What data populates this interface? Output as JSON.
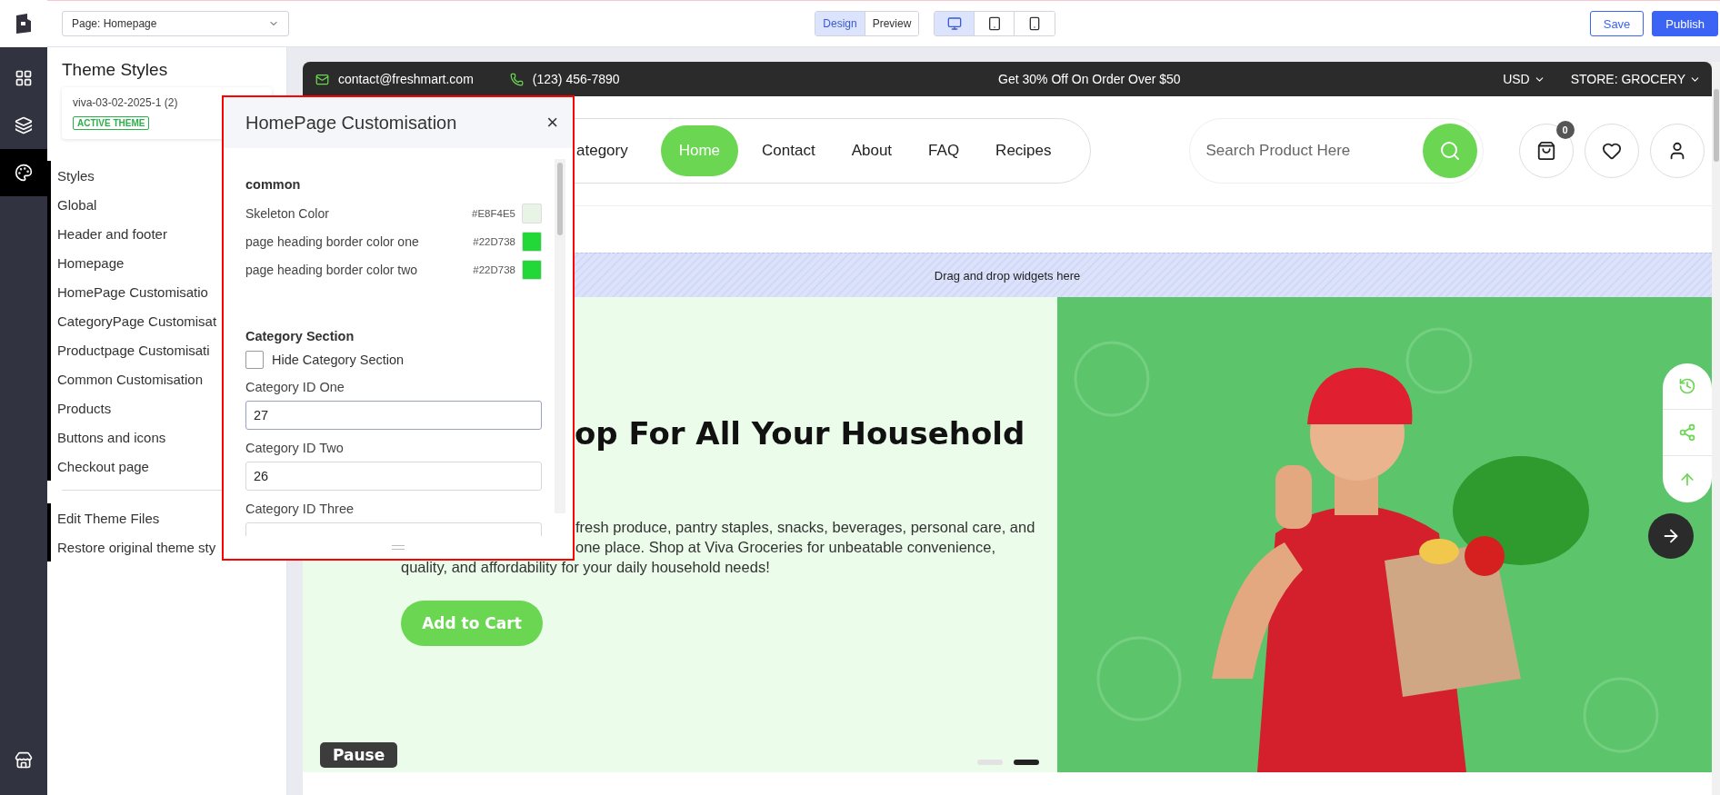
{
  "toolbar": {
    "page_select": "Page: Homepage",
    "view_modes": [
      {
        "label": "Design",
        "selected": true
      },
      {
        "label": "Preview",
        "selected": false
      }
    ],
    "devices": [
      {
        "kind": "desktop",
        "selected": true
      },
      {
        "kind": "tablet",
        "selected": false
      },
      {
        "kind": "phone",
        "selected": false
      }
    ],
    "buttons": [
      {
        "label": "Save",
        "kind": "secondary"
      },
      {
        "label": "Publish",
        "kind": "primary"
      }
    ]
  },
  "rail": [
    {
      "kind": "widgets",
      "selected": false
    },
    {
      "kind": "layers",
      "selected": false
    },
    {
      "kind": "palette",
      "selected": true
    },
    {
      "kind": "store",
      "selected": false
    }
  ],
  "sidebar": {
    "title": "Theme Styles",
    "theme": {
      "name": "viva-03-02-2025-1 (2)",
      "badge": "ACTIVE THEME"
    },
    "items": [
      "Styles",
      "Global",
      "Header and footer",
      "Homepage",
      "HomePage Customisatio",
      "CategoryPage Customisat",
      "Productpage Customisati",
      "Common Customisation",
      "Products",
      "Buttons and icons",
      "Checkout page"
    ],
    "footer_items": [
      "Edit Theme Files",
      "Restore original theme sty"
    ]
  },
  "modal": {
    "title": "HomePage Customisation",
    "close": "×",
    "sections": [
      {
        "title": "common",
        "rows": [
          {
            "kind": "color",
            "label": "Skeleton Color",
            "value": "#E8F4E5",
            "color": "#e8f4e5"
          },
          {
            "kind": "color",
            "label": "page heading border color one",
            "value": "#22D738",
            "color": "#22d738"
          },
          {
            "kind": "color",
            "label": "page heading border color two",
            "value": "#22D738",
            "color": "#22d738"
          }
        ]
      },
      {
        "title": "Category Section",
        "rows": [
          {
            "kind": "checkbox",
            "label": "Hide Category Section",
            "checked": false
          },
          {
            "kind": "input",
            "label": "Category ID One",
            "value": "27",
            "focused": true
          },
          {
            "kind": "input",
            "label": "Category ID Two",
            "value": "26",
            "focused": false
          },
          {
            "kind": "input",
            "label": "Category ID Three",
            "focused": false
          }
        ]
      }
    ]
  },
  "store": {
    "topbar": {
      "email": "contact@freshmart.com",
      "phone": "(123) 456-7890",
      "promo": "Get 30% Off On Order Over $50",
      "currency": "USD",
      "store": "STORE: GROCERY"
    },
    "nav": [
      {
        "label": "ategory",
        "selected": false
      },
      {
        "label": "Home",
        "selected": true
      },
      {
        "label": "Contact",
        "selected": false
      },
      {
        "label": "About",
        "selected": false
      },
      {
        "label": "FAQ",
        "selected": false
      },
      {
        "label": "Recipes",
        "selected": false
      }
    ],
    "search": {
      "placeholder": "Search Product Here"
    },
    "cart_count": "0",
    "drop_zone": "Drag and drop widgets here",
    "hero": {
      "heading": "op For All Your Household",
      "text_lines": [
        "fresh produce, pantry staples, snacks, beverages, personal care, and",
        "one place. Shop at Viva Groceries for unbeatable convenience,",
        "quality, and affordability for your daily household needs!"
      ],
      "button": "Add to Cart",
      "pause": "Pause",
      "slides": [
        {
          "selected": false
        },
        {
          "selected": true
        }
      ],
      "image": {
        "kind": "picture"
      }
    }
  }
}
